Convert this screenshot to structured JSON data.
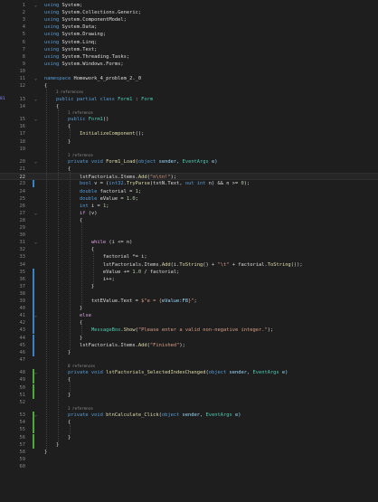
{
  "editor": {
    "gutter_marker": "81",
    "lines": [
      {
        "n": "1",
        "tokens": [
          {
            "t": "using",
            "c": "k"
          },
          {
            "t": " System;",
            "c": "p"
          }
        ]
      },
      {
        "n": "2",
        "tokens": [
          {
            "t": "using",
            "c": "k"
          },
          {
            "t": " System.Collections.Generic;",
            "c": "p"
          }
        ]
      },
      {
        "n": "3",
        "tokens": [
          {
            "t": "using",
            "c": "k"
          },
          {
            "t": " System.ComponentModel;",
            "c": "p"
          }
        ]
      },
      {
        "n": "4",
        "tokens": [
          {
            "t": "using",
            "c": "k"
          },
          {
            "t": " System.Data;",
            "c": "p"
          }
        ]
      },
      {
        "n": "5",
        "tokens": [
          {
            "t": "using",
            "c": "k"
          },
          {
            "t": " System.Drawing;",
            "c": "p"
          }
        ]
      },
      {
        "n": "6",
        "tokens": [
          {
            "t": "using",
            "c": "k"
          },
          {
            "t": " System.Linq;",
            "c": "p"
          }
        ]
      },
      {
        "n": "7",
        "tokens": [
          {
            "t": "using",
            "c": "k"
          },
          {
            "t": " System.Text;",
            "c": "p"
          }
        ]
      },
      {
        "n": "8",
        "tokens": [
          {
            "t": "using",
            "c": "k"
          },
          {
            "t": " System.Threading.Tasks;",
            "c": "p"
          }
        ]
      },
      {
        "n": "9",
        "tokens": [
          {
            "t": "using",
            "c": "k"
          },
          {
            "t": " System.Windows.Forms;",
            "c": "p"
          }
        ]
      },
      {
        "n": "10",
        "tokens": []
      },
      {
        "n": "11",
        "tokens": [
          {
            "t": "namespace",
            "c": "k"
          },
          {
            "t": " Homework_4_problem_2._0",
            "c": "p"
          }
        ]
      },
      {
        "n": "12",
        "tokens": [
          {
            "t": "{",
            "c": "p"
          }
        ]
      },
      {
        "n": "13",
        "lens": "3 references",
        "tokens": [
          {
            "t": "    public partial class ",
            "c": "k"
          },
          {
            "t": "Form1",
            "c": "t"
          },
          {
            "t": " : ",
            "c": "p"
          },
          {
            "t": "Form",
            "c": "t"
          }
        ]
      },
      {
        "n": "14",
        "tokens": [
          {
            "t": "    {",
            "c": "p"
          }
        ]
      },
      {
        "n": "15",
        "lens": "1 reference",
        "tokens": [
          {
            "t": "        public ",
            "c": "k"
          },
          {
            "t": "Form1",
            "c": "t"
          },
          {
            "t": "()",
            "c": "p"
          }
        ]
      },
      {
        "n": "16",
        "tokens": [
          {
            "t": "        {",
            "c": "p"
          }
        ]
      },
      {
        "n": "17",
        "tokens": [
          {
            "t": "            ",
            "c": "p"
          },
          {
            "t": "InitializeComponent",
            "c": "m"
          },
          {
            "t": "();",
            "c": "p"
          }
        ]
      },
      {
        "n": "18",
        "tokens": [
          {
            "t": "        }",
            "c": "p"
          }
        ]
      },
      {
        "n": "19",
        "tokens": []
      },
      {
        "n": "20",
        "lens": "1 reference",
        "tokens": [
          {
            "t": "        private void ",
            "c": "k"
          },
          {
            "t": "Form1_Load",
            "c": "m"
          },
          {
            "t": "(",
            "c": "p"
          },
          {
            "t": "object",
            "c": "k"
          },
          {
            "t": " sender, ",
            "c": "v"
          },
          {
            "t": "EventArgs",
            "c": "t"
          },
          {
            "t": " e)",
            "c": "v"
          }
        ]
      },
      {
        "n": "21",
        "tokens": [
          {
            "t": "        {",
            "c": "p"
          }
        ]
      },
      {
        "n": "22",
        "cur": true,
        "tokens": [
          {
            "t": "            lstFactorials.Items.",
            "c": "p"
          },
          {
            "t": "Add",
            "c": "m"
          },
          {
            "t": "(",
            "c": "p"
          },
          {
            "t": "\"n\\tn!\"",
            "c": "s"
          },
          {
            "t": ");",
            "c": "p"
          }
        ]
      },
      {
        "n": "23",
        "tokens": [
          {
            "t": "            ",
            "c": "p"
          },
          {
            "t": "bool",
            "c": "k"
          },
          {
            "t": " v = (",
            "c": "p"
          },
          {
            "t": "int32",
            "c": "k"
          },
          {
            "t": ".",
            "c": "p"
          },
          {
            "t": "TryParse",
            "c": "m"
          },
          {
            "t": "(txtN.Text, ",
            "c": "p"
          },
          {
            "t": "out int",
            "c": "k"
          },
          {
            "t": " n) && n >= ",
            "c": "p"
          },
          {
            "t": "0",
            "c": "n"
          },
          {
            "t": ");",
            "c": "p"
          }
        ]
      },
      {
        "n": "24",
        "tokens": [
          {
            "t": "            ",
            "c": "p"
          },
          {
            "t": "double",
            "c": "k"
          },
          {
            "t": " factorial = ",
            "c": "p"
          },
          {
            "t": "1",
            "c": "n"
          },
          {
            "t": ";",
            "c": "p"
          }
        ]
      },
      {
        "n": "25",
        "tokens": [
          {
            "t": "            ",
            "c": "p"
          },
          {
            "t": "double",
            "c": "k"
          },
          {
            "t": " eValue = ",
            "c": "p"
          },
          {
            "t": "1.0",
            "c": "n"
          },
          {
            "t": ";",
            "c": "p"
          }
        ]
      },
      {
        "n": "26",
        "tokens": [
          {
            "t": "            ",
            "c": "p"
          },
          {
            "t": "int",
            "c": "k"
          },
          {
            "t": " i = ",
            "c": "p"
          },
          {
            "t": "1",
            "c": "n"
          },
          {
            "t": ";",
            "c": "p"
          }
        ]
      },
      {
        "n": "27",
        "tokens": [
          {
            "t": "            ",
            "c": "p"
          },
          {
            "t": "if",
            "c": "ctl"
          },
          {
            "t": " (v)",
            "c": "p"
          }
        ]
      },
      {
        "n": "28",
        "tokens": [
          {
            "t": "            {",
            "c": "p"
          }
        ]
      },
      {
        "n": "29",
        "tokens": []
      },
      {
        "n": "30",
        "tokens": []
      },
      {
        "n": "31",
        "tokens": [
          {
            "t": "                ",
            "c": "p"
          },
          {
            "t": "while",
            "c": "ctl"
          },
          {
            "t": " (i <= n)",
            "c": "p"
          }
        ]
      },
      {
        "n": "32",
        "tokens": [
          {
            "t": "                {",
            "c": "p"
          }
        ]
      },
      {
        "n": "33",
        "tokens": [
          {
            "t": "                    factorial *= i;",
            "c": "p"
          }
        ]
      },
      {
        "n": "34",
        "tokens": [
          {
            "t": "                    lstFactorials.Items.",
            "c": "p"
          },
          {
            "t": "Add",
            "c": "m"
          },
          {
            "t": "(i.",
            "c": "p"
          },
          {
            "t": "ToString",
            "c": "m"
          },
          {
            "t": "() + ",
            "c": "p"
          },
          {
            "t": "\"\\t\"",
            "c": "s"
          },
          {
            "t": " + factorial.",
            "c": "p"
          },
          {
            "t": "ToString",
            "c": "m"
          },
          {
            "t": "());",
            "c": "p"
          }
        ]
      },
      {
        "n": "35",
        "tokens": [
          {
            "t": "                    eValue += ",
            "c": "p"
          },
          {
            "t": "1.0",
            "c": "n"
          },
          {
            "t": " / factorial;",
            "c": "p"
          }
        ]
      },
      {
        "n": "36",
        "tokens": [
          {
            "t": "                    i++;",
            "c": "p"
          }
        ]
      },
      {
        "n": "37",
        "tokens": [
          {
            "t": "                }",
            "c": "p"
          }
        ]
      },
      {
        "n": "38",
        "tokens": []
      },
      {
        "n": "39",
        "tokens": [
          {
            "t": "                txtEValue.Text = ",
            "c": "p"
          },
          {
            "t": "$\"e = {",
            "c": "s"
          },
          {
            "t": "eValue:F8",
            "c": "v"
          },
          {
            "t": "}\"",
            "c": "s"
          },
          {
            "t": ";",
            "c": "p"
          }
        ]
      },
      {
        "n": "40",
        "tokens": [
          {
            "t": "            }",
            "c": "p"
          }
        ]
      },
      {
        "n": "41",
        "tokens": [
          {
            "t": "            ",
            "c": "p"
          },
          {
            "t": "else",
            "c": "ctl"
          }
        ]
      },
      {
        "n": "42",
        "tokens": [
          {
            "t": "            {",
            "c": "p"
          }
        ]
      },
      {
        "n": "43",
        "tokens": [
          {
            "t": "                ",
            "c": "p"
          },
          {
            "t": "MessageBox",
            "c": "t"
          },
          {
            "t": ".",
            "c": "p"
          },
          {
            "t": "Show",
            "c": "m"
          },
          {
            "t": "(",
            "c": "p"
          },
          {
            "t": "\"Please enter a valid non-negative integer.\"",
            "c": "s"
          },
          {
            "t": ");",
            "c": "p"
          }
        ]
      },
      {
        "n": "44",
        "tokens": [
          {
            "t": "            }",
            "c": "p"
          }
        ]
      },
      {
        "n": "45",
        "tokens": [
          {
            "t": "            lstFactorials.Items.",
            "c": "p"
          },
          {
            "t": "Add",
            "c": "m"
          },
          {
            "t": "(",
            "c": "p"
          },
          {
            "t": "\"Finished\"",
            "c": "s"
          },
          {
            "t": ");",
            "c": "p"
          }
        ]
      },
      {
        "n": "46",
        "tokens": [
          {
            "t": "        }",
            "c": "p"
          }
        ]
      },
      {
        "n": "47",
        "tokens": []
      },
      {
        "n": "48",
        "lens": "0 references",
        "tokens": [
          {
            "t": "        private void ",
            "c": "k"
          },
          {
            "t": "lstFactorials_SelectedIndexChanged",
            "c": "m"
          },
          {
            "t": "(",
            "c": "p"
          },
          {
            "t": "object",
            "c": "k"
          },
          {
            "t": " sender, ",
            "c": "v"
          },
          {
            "t": "EventArgs",
            "c": "t"
          },
          {
            "t": " e)",
            "c": "v"
          }
        ]
      },
      {
        "n": "49",
        "tokens": [
          {
            "t": "        {",
            "c": "p"
          }
        ]
      },
      {
        "n": "50",
        "tokens": []
      },
      {
        "n": "51",
        "tokens": [
          {
            "t": "        }",
            "c": "p"
          }
        ]
      },
      {
        "n": "52",
        "tokens": []
      },
      {
        "n": "53",
        "lens": "1 reference",
        "tokens": [
          {
            "t": "        private void ",
            "c": "k"
          },
          {
            "t": "btnCalculate_Click",
            "c": "m"
          },
          {
            "t": "(",
            "c": "p"
          },
          {
            "t": "object",
            "c": "k"
          },
          {
            "t": " sender, ",
            "c": "v"
          },
          {
            "t": "EventArgs",
            "c": "t"
          },
          {
            "t": " e)",
            "c": "v"
          }
        ]
      },
      {
        "n": "54",
        "tokens": [
          {
            "t": "        {",
            "c": "p"
          }
        ]
      },
      {
        "n": "55",
        "tokens": []
      },
      {
        "n": "56",
        "tokens": [
          {
            "t": "        }",
            "c": "p"
          }
        ]
      },
      {
        "n": "57",
        "tokens": [
          {
            "t": "    }",
            "c": "p"
          }
        ]
      },
      {
        "n": "58",
        "tokens": [
          {
            "t": "}",
            "c": "p"
          }
        ]
      },
      {
        "n": "59",
        "tokens": []
      },
      {
        "n": "60",
        "tokens": []
      }
    ],
    "colors": {
      "background": "#1e1e1e",
      "keyword": "#569cd6",
      "type": "#4ec9b0",
      "method": "#dcdcaa",
      "string": "#d69d85",
      "number": "#b5cea8",
      "change_saved": "#3a82c6",
      "change_unsaved": "#4ea83a"
    }
  }
}
